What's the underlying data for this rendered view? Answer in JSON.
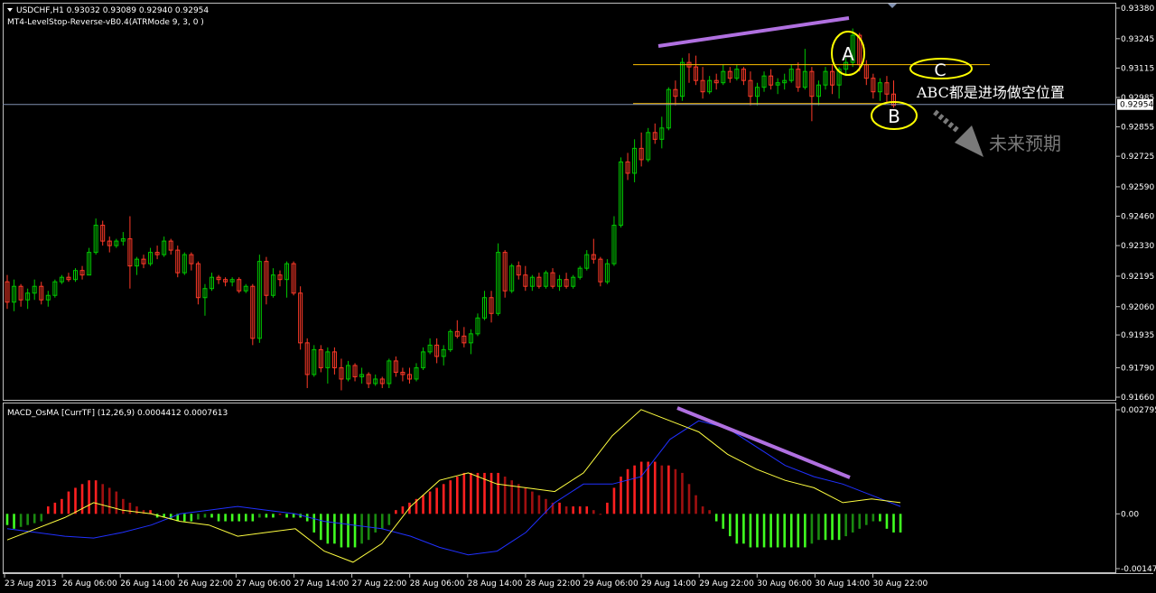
{
  "colors": {
    "background": "#000000",
    "frame": "#c0c0c0",
    "up": "#00c800",
    "down": "#ff3a28",
    "macd_pos": "#ff2020",
    "macd_pos_dark": "#a01010",
    "macd_neg": "#40ff20",
    "macd_neg_dark": "#1a8a10",
    "signal": "#2030ff",
    "macd_line": "#ffff40",
    "trend": "#b070e0",
    "level": "#ffc000",
    "current": "#8090b0",
    "circle": "#ffff00",
    "note_text": "#ffffff",
    "arrow": "#7a7a7a"
  },
  "header": {
    "symbol_line": "USDCHF,H1  0.93032 0.93089 0.92940 0.92954",
    "indicator_line": "MT4-LevelStop-Reverse-vB0.4(ATRMode 9, 3, 0 )",
    "dropdown_icon": "triangle-down-icon"
  },
  "annotations": {
    "label_a": "A",
    "label_b": "B",
    "label_c": "C",
    "note": "ABC都是进场做空位置",
    "expectation": "未来预期"
  },
  "price_axis": {
    "ticks": [
      "0.93380",
      "0.93245",
      "0.93115",
      "0.92985",
      "0.92855",
      "0.92725",
      "0.92590",
      "0.92460",
      "0.92330",
      "0.92195",
      "0.92060",
      "0.91935",
      "0.91790",
      "0.91660"
    ],
    "current_price": "0.92954"
  },
  "macd_panel": {
    "title": "MACD_OsMA [CurrTF] (12,26,9) 0.0004412 0.0007613",
    "ticks": [
      "0.002795",
      "0.00",
      "-0.001471"
    ]
  },
  "time_axis": {
    "labels": [
      "23 Aug 2013",
      "26 Aug 06:00",
      "26 Aug 14:00",
      "26 Aug 22:00",
      "27 Aug 06:00",
      "27 Aug 14:00",
      "27 Aug 22:00",
      "28 Aug 06:00",
      "28 Aug 14:00",
      "28 Aug 22:00",
      "29 Aug 06:00",
      "29 Aug 14:00",
      "29 Aug 22:00",
      "30 Aug 06:00",
      "30 Aug 14:00",
      "30 Aug 22:00"
    ]
  },
  "chart_data": {
    "type": "candlestick",
    "symbol": "USDCHF",
    "timeframe": "H1",
    "ylim": [
      0.9166,
      0.9338
    ],
    "grid": false,
    "candles": [
      [
        0.9217,
        0.922,
        0.9205,
        0.9208
      ],
      [
        0.9208,
        0.9218,
        0.9204,
        0.9215
      ],
      [
        0.9215,
        0.9216,
        0.9206,
        0.9209
      ],
      [
        0.9209,
        0.9214,
        0.9205,
        0.9212
      ],
      [
        0.9212,
        0.9218,
        0.9209,
        0.9215
      ],
      [
        0.9215,
        0.9217,
        0.9207,
        0.9209
      ],
      [
        0.9209,
        0.9213,
        0.9206,
        0.9211
      ],
      [
        0.9211,
        0.9218,
        0.921,
        0.9217
      ],
      [
        0.9217,
        0.922,
        0.9216,
        0.9219
      ],
      [
        0.9219,
        0.9221,
        0.9217,
        0.9218
      ],
      [
        0.9218,
        0.9223,
        0.9217,
        0.9222
      ],
      [
        0.9222,
        0.9224,
        0.9218,
        0.922
      ],
      [
        0.922,
        0.9232,
        0.922,
        0.923
      ],
      [
        0.923,
        0.9245,
        0.9229,
        0.9242
      ],
      [
        0.9242,
        0.9244,
        0.9233,
        0.9235
      ],
      [
        0.9235,
        0.9237,
        0.923,
        0.9233
      ],
      [
        0.9233,
        0.9236,
        0.9232,
        0.9235
      ],
      [
        0.9235,
        0.9239,
        0.9233,
        0.9236
      ],
      [
        0.9236,
        0.9246,
        0.9214,
        0.9224
      ],
      [
        0.9224,
        0.9228,
        0.922,
        0.9227
      ],
      [
        0.9227,
        0.9229,
        0.9223,
        0.9225
      ],
      [
        0.9225,
        0.9232,
        0.9224,
        0.923
      ],
      [
        0.923,
        0.9233,
        0.9227,
        0.9229
      ],
      [
        0.9229,
        0.9237,
        0.9228,
        0.9235
      ],
      [
        0.9235,
        0.9236,
        0.9229,
        0.9231
      ],
      [
        0.9231,
        0.9233,
        0.9219,
        0.9221
      ],
      [
        0.9221,
        0.923,
        0.922,
        0.9229
      ],
      [
        0.9229,
        0.923,
        0.9222,
        0.9225
      ],
      [
        0.9225,
        0.9226,
        0.9207,
        0.921
      ],
      [
        0.921,
        0.9216,
        0.9202,
        0.9214
      ],
      [
        0.9214,
        0.9221,
        0.9213,
        0.9219
      ],
      [
        0.9219,
        0.922,
        0.9216,
        0.9218
      ],
      [
        0.9218,
        0.9219,
        0.9215,
        0.9217
      ],
      [
        0.9217,
        0.9219,
        0.9215,
        0.9218
      ],
      [
        0.9218,
        0.9219,
        0.9212,
        0.9213
      ],
      [
        0.9213,
        0.9216,
        0.9212,
        0.9215
      ],
      [
        0.9215,
        0.9216,
        0.9189,
        0.9192
      ],
      [
        0.9192,
        0.9229,
        0.919,
        0.9226
      ],
      [
        0.9226,
        0.9228,
        0.9207,
        0.9211
      ],
      [
        0.9211,
        0.9223,
        0.921,
        0.922
      ],
      [
        0.922,
        0.9222,
        0.9215,
        0.9218
      ],
      [
        0.9218,
        0.9226,
        0.921,
        0.9225
      ],
      [
        0.9225,
        0.9226,
        0.9211,
        0.9212
      ],
      [
        0.9212,
        0.9215,
        0.9187,
        0.919
      ],
      [
        0.919,
        0.9192,
        0.917,
        0.9176
      ],
      [
        0.9176,
        0.9189,
        0.9175,
        0.9187
      ],
      [
        0.9187,
        0.9189,
        0.9177,
        0.9179
      ],
      [
        0.9179,
        0.9188,
        0.9172,
        0.9186
      ],
      [
        0.9186,
        0.9188,
        0.9176,
        0.9179
      ],
      [
        0.9179,
        0.9183,
        0.9169,
        0.9174
      ],
      [
        0.9174,
        0.9182,
        0.9173,
        0.918
      ],
      [
        0.918,
        0.9181,
        0.9173,
        0.9175
      ],
      [
        0.9175,
        0.9179,
        0.9172,
        0.9176
      ],
      [
        0.9176,
        0.9177,
        0.917,
        0.9172
      ],
      [
        0.9172,
        0.9176,
        0.9171,
        0.9174
      ],
      [
        0.9174,
        0.9175,
        0.917,
        0.9172
      ],
      [
        0.9172,
        0.9183,
        0.917,
        0.9182
      ],
      [
        0.9182,
        0.9184,
        0.9175,
        0.9177
      ],
      [
        0.9177,
        0.9179,
        0.9173,
        0.9176
      ],
      [
        0.9176,
        0.9179,
        0.9172,
        0.9174
      ],
      [
        0.9174,
        0.9181,
        0.9173,
        0.9179
      ],
      [
        0.9179,
        0.9188,
        0.9178,
        0.9186
      ],
      [
        0.9186,
        0.9192,
        0.9185,
        0.9189
      ],
      [
        0.9189,
        0.9192,
        0.9181,
        0.9184
      ],
      [
        0.9184,
        0.9189,
        0.918,
        0.9187
      ],
      [
        0.9187,
        0.9196,
        0.9186,
        0.9195
      ],
      [
        0.9195,
        0.92,
        0.9192,
        0.9193
      ],
      [
        0.9193,
        0.9197,
        0.9188,
        0.919
      ],
      [
        0.919,
        0.9196,
        0.9185,
        0.9194
      ],
      [
        0.9194,
        0.9203,
        0.9193,
        0.9201
      ],
      [
        0.9201,
        0.9213,
        0.92,
        0.921
      ],
      [
        0.921,
        0.9213,
        0.9199,
        0.9203
      ],
      [
        0.9203,
        0.9234,
        0.9202,
        0.923
      ],
      [
        0.923,
        0.9231,
        0.921,
        0.9213
      ],
      [
        0.9213,
        0.9225,
        0.9212,
        0.9224
      ],
      [
        0.9224,
        0.9226,
        0.9218,
        0.922
      ],
      [
        0.922,
        0.9224,
        0.9213,
        0.9215
      ],
      [
        0.9215,
        0.922,
        0.9213,
        0.9219
      ],
      [
        0.9219,
        0.9221,
        0.9214,
        0.9215
      ],
      [
        0.9215,
        0.9222,
        0.9214,
        0.9221
      ],
      [
        0.9221,
        0.9223,
        0.9214,
        0.9215
      ],
      [
        0.9215,
        0.922,
        0.9213,
        0.9218
      ],
      [
        0.9218,
        0.9221,
        0.9214,
        0.9215
      ],
      [
        0.9215,
        0.922,
        0.9214,
        0.9219
      ],
      [
        0.9219,
        0.9224,
        0.9218,
        0.9223
      ],
      [
        0.9223,
        0.9231,
        0.9222,
        0.9229
      ],
      [
        0.9229,
        0.9236,
        0.9225,
        0.9227
      ],
      [
        0.9227,
        0.9228,
        0.9215,
        0.9217
      ],
      [
        0.9217,
        0.9227,
        0.9216,
        0.9225
      ],
      [
        0.9225,
        0.9246,
        0.9224,
        0.9242
      ],
      [
        0.9242,
        0.9272,
        0.9241,
        0.927
      ],
      [
        0.927,
        0.9274,
        0.9262,
        0.9265
      ],
      [
        0.9265,
        0.928,
        0.9261,
        0.9276
      ],
      [
        0.9276,
        0.9283,
        0.9268,
        0.9271
      ],
      [
        0.9271,
        0.9285,
        0.927,
        0.9283
      ],
      [
        0.9283,
        0.9287,
        0.9278,
        0.928
      ],
      [
        0.928,
        0.929,
        0.9276,
        0.9285
      ],
      [
        0.9285,
        0.9303,
        0.9284,
        0.9302
      ],
      [
        0.9302,
        0.9306,
        0.9295,
        0.9299
      ],
      [
        0.9299,
        0.9316,
        0.9297,
        0.9314
      ],
      [
        0.9314,
        0.9318,
        0.9305,
        0.9312
      ],
      [
        0.9312,
        0.9317,
        0.9304,
        0.9306
      ],
      [
        0.9306,
        0.9312,
        0.9298,
        0.9301
      ],
      [
        0.9301,
        0.9308,
        0.93,
        0.9306
      ],
      [
        0.9306,
        0.9309,
        0.9302,
        0.9305
      ],
      [
        0.9305,
        0.9313,
        0.9304,
        0.931
      ],
      [
        0.931,
        0.9312,
        0.9305,
        0.9307
      ],
      [
        0.9307,
        0.9313,
        0.9306,
        0.9311
      ],
      [
        0.9311,
        0.9312,
        0.9304,
        0.9306
      ],
      [
        0.9306,
        0.931,
        0.9295,
        0.9299
      ],
      [
        0.9299,
        0.9305,
        0.9295,
        0.9303
      ],
      [
        0.9303,
        0.931,
        0.9301,
        0.9308
      ],
      [
        0.9308,
        0.9311,
        0.9302,
        0.9304
      ],
      [
        0.9304,
        0.9307,
        0.93,
        0.9305
      ],
      [
        0.9305,
        0.9309,
        0.9302,
        0.9306
      ],
      [
        0.9306,
        0.9313,
        0.9305,
        0.9311
      ],
      [
        0.9311,
        0.9314,
        0.9301,
        0.9303
      ],
      [
        0.9303,
        0.932,
        0.9302,
        0.931
      ],
      [
        0.931,
        0.9312,
        0.9288,
        0.9299
      ],
      [
        0.9299,
        0.9306,
        0.9295,
        0.9304
      ],
      [
        0.9304,
        0.9312,
        0.9302,
        0.931
      ],
      [
        0.931,
        0.9313,
        0.93,
        0.9304
      ],
      [
        0.9304,
        0.9312,
        0.9298,
        0.9311
      ],
      [
        0.9311,
        0.9316,
        0.9308,
        0.9314
      ],
      [
        0.9314,
        0.9329,
        0.9312,
        0.9326
      ],
      [
        0.9326,
        0.9327,
        0.931,
        0.9313
      ],
      [
        0.9313,
        0.9315,
        0.9304,
        0.9307
      ],
      [
        0.9307,
        0.9309,
        0.9298,
        0.9301
      ],
      [
        0.9301,
        0.9307,
        0.9297,
        0.9305
      ],
      [
        0.9305,
        0.9308,
        0.9296,
        0.93
      ],
      [
        0.93,
        0.9306,
        0.9294,
        0.9295
      ]
    ],
    "levels": {
      "resistance": 0.9313,
      "support": 0.9296,
      "current": 0.92954
    },
    "trendline": [
      [
        97,
        0.932
      ],
      [
        125,
        0.9333
      ]
    ],
    "macd": {
      "ylim": [
        -0.001471,
        0.002795
      ],
      "histogram": [
        -0.0003,
        -0.0004,
        -0.00035,
        -0.0003,
        -0.00025,
        -0.0002,
        0.0002,
        0.0003,
        0.0004,
        0.0006,
        0.0007,
        0.0008,
        0.0009,
        0.0009,
        0.0008,
        0.0007,
        0.0006,
        0.0004,
        0.0003,
        0.0002,
        0.0001,
        0.0001,
        -0.0001,
        -0.0001,
        -0.00015,
        -0.0002,
        -0.0002,
        -0.0002,
        -0.00015,
        -0.0001,
        -0.0001,
        -0.0002,
        -0.0002,
        -0.0002,
        -0.0002,
        -0.0002,
        -0.0002,
        -0.0001,
        -0.0001,
        -0.0001,
        0.0,
        -0.0001,
        -0.0001,
        -0.0001,
        -0.0002,
        -0.0005,
        -0.0007,
        -0.0008,
        -0.0008,
        -0.0009,
        -0.0009,
        -0.0009,
        -0.0008,
        -0.0007,
        -0.0005,
        -0.0004,
        -0.0003,
        0.0001,
        0.0002,
        0.0003,
        0.0004,
        0.0005,
        0.0006,
        0.0007,
        0.0008,
        0.0009,
        0.001,
        0.0011,
        0.0011,
        0.0011,
        0.0011,
        0.0011,
        0.0011,
        0.001,
        0.0009,
        0.0008,
        0.0007,
        0.0006,
        0.0005,
        0.0004,
        0.0003,
        0.0003,
        0.0002,
        0.0002,
        0.0002,
        0.0002,
        0.0001,
        0.0,
        0.0003,
        0.0007,
        0.001,
        0.0012,
        0.0013,
        0.0014,
        0.0014,
        0.0014,
        0.0013,
        0.0013,
        0.0012,
        0.0011,
        0.0008,
        0.0005,
        0.0002,
        0.0001,
        -0.0002,
        -0.0004,
        -0.0006,
        -0.0008,
        -0.0008,
        -0.0009,
        -0.0009,
        -0.0009,
        -0.0009,
        -0.0009,
        -0.0009,
        -0.0009,
        -0.0009,
        -0.0009,
        -0.0008,
        -0.0007,
        -0.0007,
        -0.0007,
        -0.0007,
        -0.0006,
        -0.0005,
        -0.0004,
        -0.0003,
        -0.0002,
        -0.0002,
        -0.0004,
        -0.0005,
        -0.0005
      ],
      "signal_line": [
        -0.0004,
        -0.0005,
        -0.0006,
        -0.00065,
        -0.0005,
        -0.0003,
        0.0,
        0.0001,
        0.0002,
        0.0001,
        0.0,
        -0.0002,
        -0.0003,
        -0.0004,
        -0.0006,
        -0.0009,
        -0.0011,
        -0.001,
        -0.0005,
        0.0003,
        0.0008,
        0.0008,
        0.001,
        0.002,
        0.0025,
        0.0023,
        0.0018,
        0.0013,
        0.001,
        0.0008,
        0.0005,
        0.0002
      ],
      "macd_line": [
        -0.0007,
        -0.0004,
        -0.0001,
        0.0003,
        0.0001,
        0.0,
        -0.0002,
        -0.0003,
        -0.0006,
        -0.0005,
        -0.0004,
        -0.001,
        -0.0013,
        -0.0008,
        0.0002,
        0.0009,
        0.0011,
        0.0008,
        0.0007,
        0.0006,
        0.0011,
        0.0021,
        0.0028,
        0.0025,
        0.0022,
        0.0016,
        0.0012,
        0.0009,
        0.0007,
        0.0003,
        0.0004,
        0.0003
      ]
    }
  }
}
